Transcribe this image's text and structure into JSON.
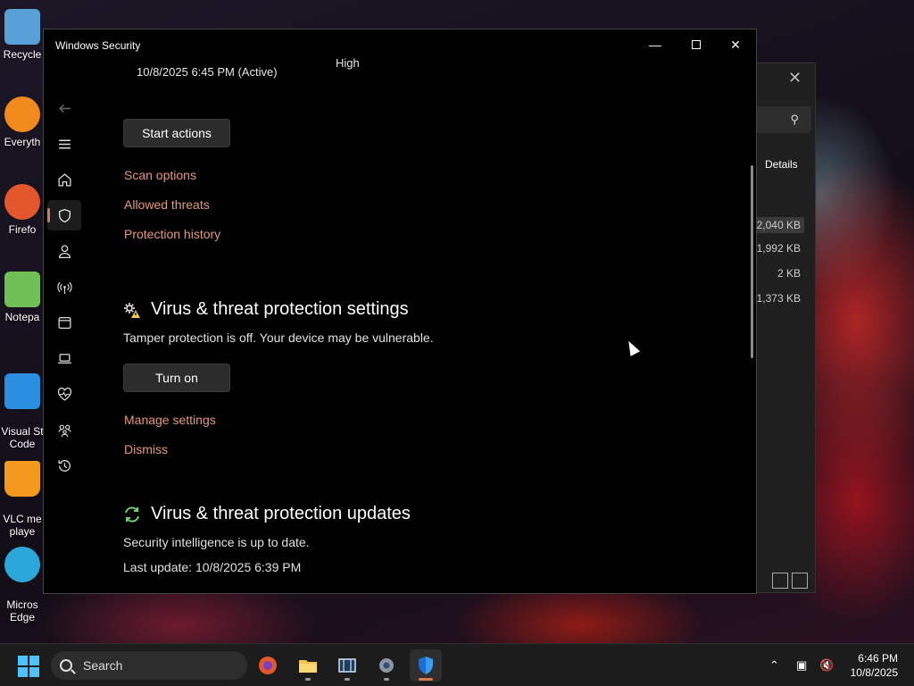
{
  "desktop": {
    "icons": [
      {
        "label": "Recycle",
        "color": "#5aa0d8"
      },
      {
        "label": "Everyth",
        "color": "#f08a1c"
      },
      {
        "label": "Firefo",
        "color": "#e3572c"
      },
      {
        "label": "Notepa",
        "color": "#6fbf56"
      },
      {
        "label": "Visual St\nCode",
        "color": "#2a8fe0"
      },
      {
        "label": "VLC me\nplaye",
        "color": "#f39a1e"
      },
      {
        "label": "Micros\nEdge",
        "color": "#2aa6d8"
      }
    ]
  },
  "explorer": {
    "close_glyph": "✕",
    "search_icon": "search-icon",
    "details_label": "Details",
    "sizes": [
      "2,040 KB",
      "1,992 KB",
      "2 KB",
      "01,373 KB"
    ]
  },
  "window": {
    "title": "Windows Security",
    "controls": {
      "minimize": "—",
      "close": "✕"
    }
  },
  "rail": {
    "items": [
      "back-icon",
      "menu-icon",
      "home-icon",
      "shield-icon",
      "account-icon",
      "network-icon",
      "app-browser-icon",
      "device-security-icon",
      "health-icon",
      "family-icon",
      "history-icon",
      "settings-icon"
    ],
    "active": "shield-icon"
  },
  "scan": {
    "last_scan": "10/8/2025 6:45 PM (Active)",
    "severity": "High",
    "start_actions": "Start actions",
    "links": [
      "Scan options",
      "Allowed threats",
      "Protection history"
    ]
  },
  "settings_section": {
    "heading": "Virus & threat protection settings",
    "status": "Tamper protection is off. Your device may be vulnerable.",
    "button": "Turn on",
    "links": [
      "Manage settings",
      "Dismiss"
    ]
  },
  "updates_section": {
    "heading": "Virus & threat protection updates",
    "status": "Security intelligence is up to date.",
    "last_update": "Last update: 10/8/2025 6:39 PM"
  },
  "taskbar": {
    "search_label": "Search",
    "time": "6:46 PM",
    "date": "10/8/2025",
    "accent": "#d97a4e"
  }
}
